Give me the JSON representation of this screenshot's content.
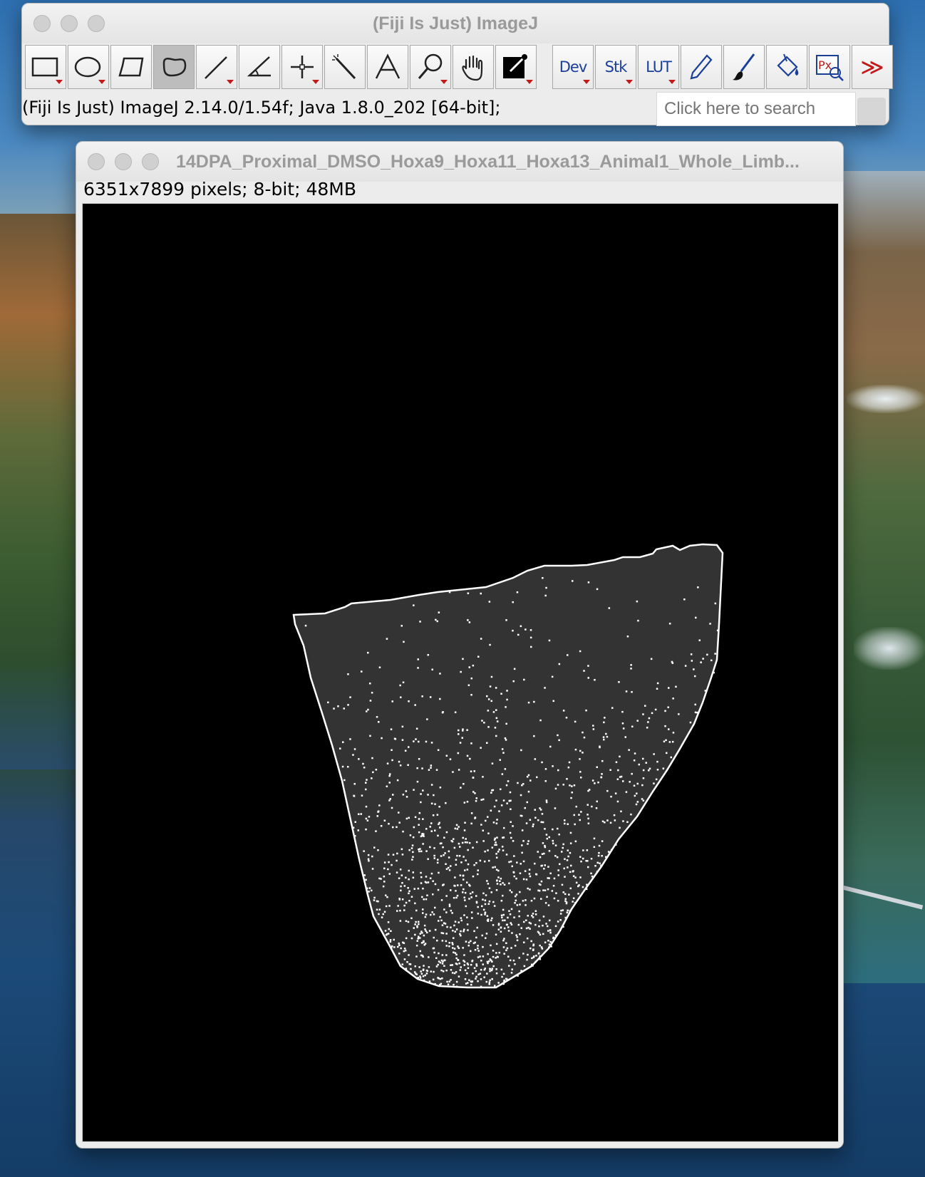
{
  "imagej_window": {
    "title": "(Fiji Is Just) ImageJ",
    "status": "(Fiji Is Just) ImageJ 2.14.0/1.54f; Java 1.8.0_202 [64-bit];",
    "search_placeholder": "Click here to search",
    "tools": [
      {
        "name": "rectangle-tool",
        "selected": false
      },
      {
        "name": "oval-tool",
        "selected": false
      },
      {
        "name": "polygon-tool",
        "selected": false
      },
      {
        "name": "freehand-tool",
        "selected": true
      },
      {
        "name": "line-tool",
        "selected": false
      },
      {
        "name": "angle-tool",
        "selected": false
      },
      {
        "name": "point-tool",
        "selected": false
      },
      {
        "name": "wand-tool",
        "selected": false
      },
      {
        "name": "text-tool",
        "selected": false
      },
      {
        "name": "magnifier-tool",
        "selected": false
      },
      {
        "name": "hand-tool",
        "selected": false
      },
      {
        "name": "color-picker-tool",
        "selected": false
      }
    ],
    "menu_tools": {
      "dev_label": "Dev",
      "stk_label": "Stk",
      "lut_label": "LUT",
      "px_label": "Px",
      "more_label": "≫"
    }
  },
  "image_window": {
    "title": "14DPA_Proximal_DMSO_Hoxa9_Hoxa11_Hoxa13_Animal1_Whole_Limb...",
    "info": "6351x7899 pixels; 8-bit; 48MB"
  },
  "colors": {
    "canvas_background": "#000000",
    "region_fill": "#333333",
    "outline": "#ffffff",
    "accent_red": "#c21a1a",
    "accent_blue": "#1a3f9a"
  }
}
